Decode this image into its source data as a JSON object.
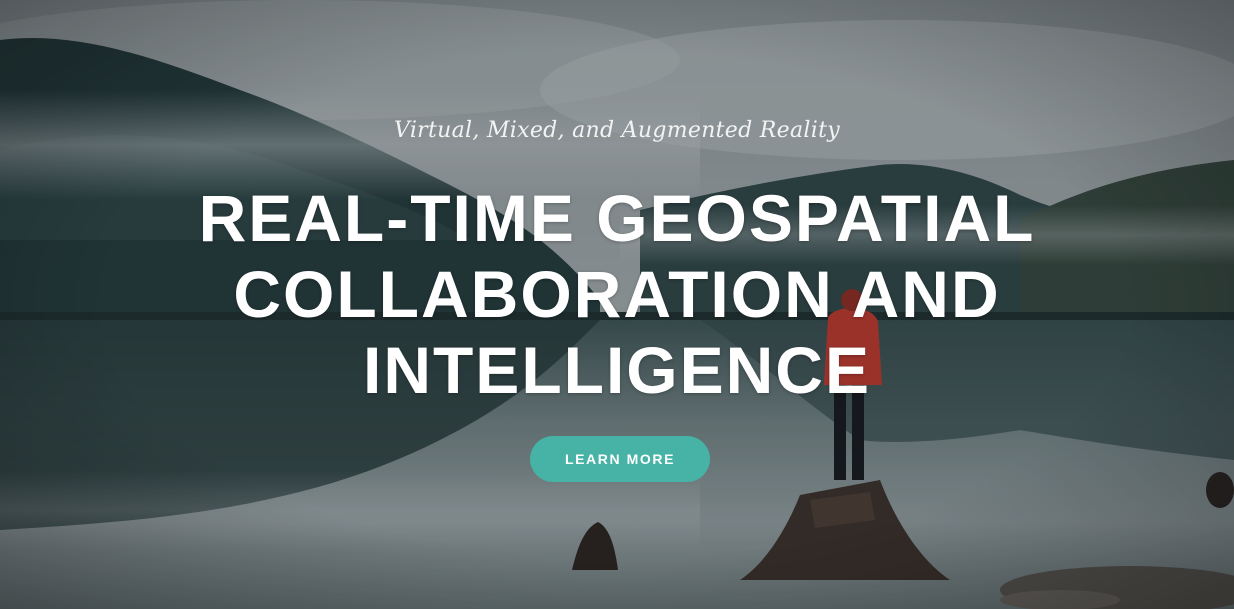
{
  "hero": {
    "eyebrow": "Virtual, Mixed, and Augmented Reality",
    "headline_lines": [
      "REAL-TIME GEOSPATIAL",
      "COLLABORATION AND",
      "INTELLIGENCE"
    ],
    "cta_label": "LEARN MORE",
    "background_image": "misty-lake-mountains-person-on-stump"
  },
  "colors": {
    "accent": "#46b3a6",
    "text": "#ffffff"
  }
}
